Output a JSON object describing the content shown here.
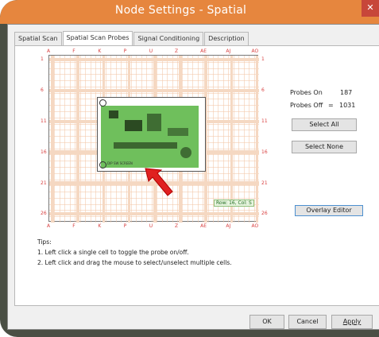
{
  "window": {
    "title": "Node Settings - Spatial",
    "close_glyph": "✕"
  },
  "tabs": [
    {
      "label": "Spatial Scan"
    },
    {
      "label": "Spatial Scan Probes"
    },
    {
      "label": "Signal Conditioning"
    },
    {
      "label": "Description"
    }
  ],
  "grid": {
    "column_labels": [
      "A",
      "F",
      "K",
      "P",
      "U",
      "Z",
      "AE",
      "AJ",
      "AO"
    ],
    "row_labels": [
      "1",
      "6",
      "11",
      "16",
      "21",
      "26"
    ],
    "hover_tooltip": "Row: 16, Col: S",
    "pcb_text": "DIP SW SCREEN",
    "colors": {
      "grid_line": "#f2c6a8",
      "grid_band": "#f5d8c2",
      "probe_on": "#5fb84a",
      "label": "#d94040"
    }
  },
  "probes": {
    "on_label": "Probes On",
    "on_value": "187",
    "off_label": "Probes Off",
    "off_sep": "=",
    "off_value": "1031"
  },
  "buttons": {
    "select_all": "Select All",
    "select_none": "Select None",
    "overlay_editor": "Overlay Editor",
    "ok": "OK",
    "cancel": "Cancel",
    "apply": "Apply"
  },
  "tips": {
    "heading": "Tips:",
    "line1": "1. Left click a single cell to toggle the probe on/off.",
    "line2": "2. Left click and drag the mouse to select/unselect multiple cells."
  }
}
